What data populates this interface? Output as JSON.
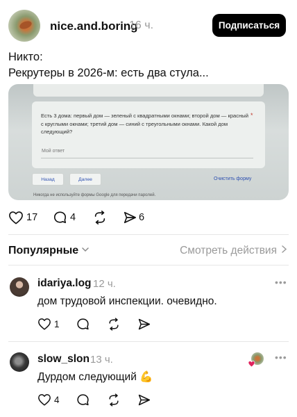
{
  "post": {
    "username": "nice.and.boring",
    "time": "16 ч.",
    "follow_label": "Подписаться",
    "line1": "Никто:",
    "line2": "Рекрутеры в 2026-м: есть два стула..."
  },
  "photo": {
    "question": "Есть 3 дома: первый дом — зеленый с квадратными окнами; второй дом — красный с круглыми окнами; третий дом — синий с треугольными окнами. Какой дом следующий?",
    "required_mark": "*",
    "answer_label": "Мой ответ",
    "back_label": "Назад",
    "next_label": "Далее",
    "clear_label": "Очистить форму",
    "never_text": "Никогда не используйте формы Google для передачи паролей."
  },
  "actions": {
    "likes": "17",
    "comments": "4",
    "shares": "6"
  },
  "sort": {
    "popular_label": "Популярные",
    "see_actions_label": "Смотреть действия"
  },
  "comments": [
    {
      "username": "idariya.log",
      "time": "12 ч.",
      "text": "дом трудовой инспекции. очевидно.",
      "likes": "1"
    },
    {
      "username": "slow_slon",
      "time": "13 ч.",
      "text": "Дурдом следующий 💪",
      "likes": "4"
    }
  ],
  "colors": {
    "accent": "#000000",
    "muted": "#9a9a9a",
    "link_blue": "#2c4fb0",
    "heart_red": "#e0245e"
  }
}
